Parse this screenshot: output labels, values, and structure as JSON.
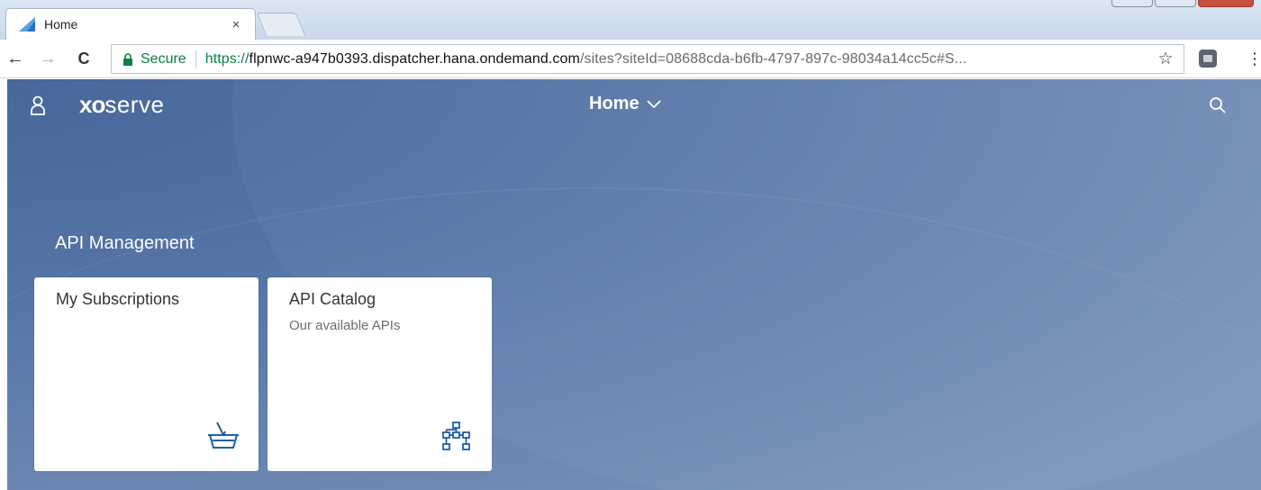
{
  "browser": {
    "tab_title": "Home",
    "tab_close": "×",
    "back": "←",
    "forward": "→",
    "reload": "C",
    "secure_label": "Secure",
    "url_scheme": "https://",
    "url_host": "flpnwc-a947b0393.dispatcher.hana.ondemand.com",
    "url_rest": "/sites?siteId=08688cda-b6fb-4797-897c-98034a14cc5c#S...",
    "star": "☆",
    "menu": "⋮"
  },
  "shell": {
    "logo_prefix": "xo",
    "logo_suffix": "serve",
    "home_title": "Home",
    "group_title": "API Management"
  },
  "tiles": [
    {
      "title": "My Subscriptions",
      "subtitle": "",
      "icon": "basket-icon"
    },
    {
      "title": "API Catalog",
      "subtitle": "Our available APIs",
      "icon": "network-icon"
    }
  ],
  "colors": {
    "shell_background": "#5474a5",
    "tile_icon": "#1f5fa8",
    "secure_green": "#0b8043"
  }
}
